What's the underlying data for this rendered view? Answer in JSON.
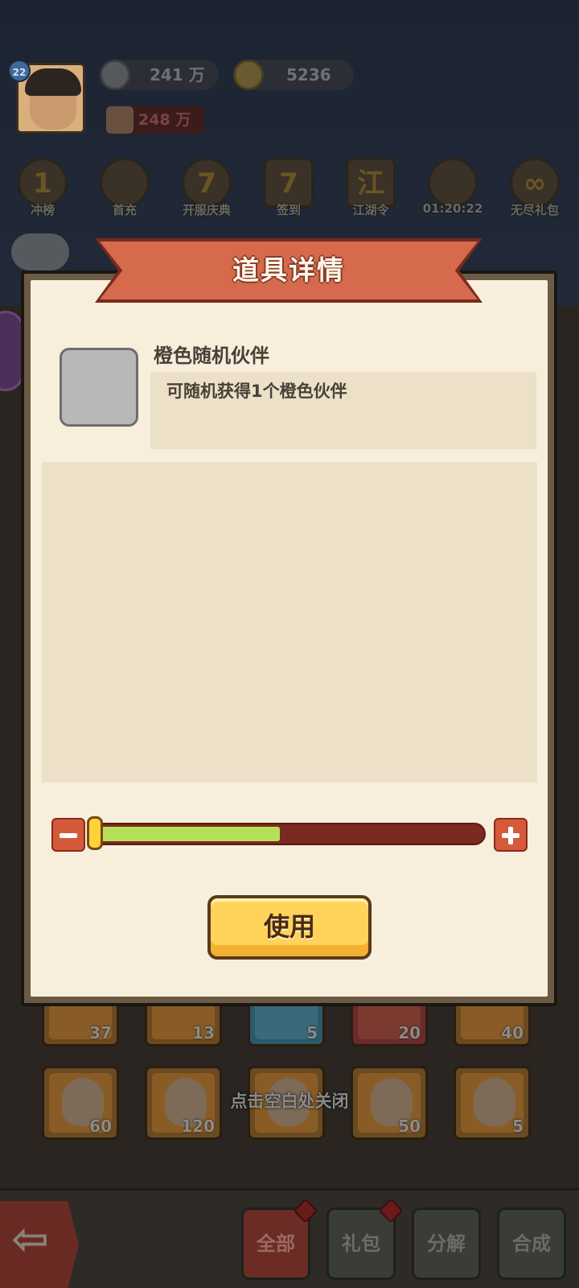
{
  "player": {
    "level": "22",
    "silver": "241 万",
    "gold": "5236",
    "power": "248 万"
  },
  "menu": [
    {
      "label": "冲榜",
      "glyph": "1",
      "icon": "rank-icon"
    },
    {
      "label": "首充",
      "glyph": "",
      "icon": "first-charge-icon"
    },
    {
      "label": "开服庆典",
      "glyph": "7",
      "icon": "celebration-icon"
    },
    {
      "label": "签到",
      "glyph": "7",
      "icon": "calendar-icon"
    },
    {
      "label": "江湖令",
      "glyph": "江",
      "icon": "token-icon"
    },
    {
      "label": "01:20:22",
      "glyph": "",
      "icon": "gift-icon"
    },
    {
      "label": "无尽礼包",
      "glyph": "∞",
      "icon": "infinity-icon"
    }
  ],
  "grid": {
    "row1_counts": [
      "37",
      "13",
      "5",
      "20",
      "40"
    ],
    "row2_counts": [
      "60",
      "120",
      "",
      "50",
      "5"
    ]
  },
  "dialog": {
    "title": "道具详情",
    "item_name": "橙色随机伙伴",
    "item_desc": "可随机获得1个橙色伙伴",
    "use_label": "使用",
    "slider_fraction": 0.48
  },
  "close_hint": "点击空白处关闭",
  "tabs": [
    {
      "label": "全部",
      "active": true,
      "dot": true
    },
    {
      "label": "礼包",
      "active": false,
      "dot": true
    },
    {
      "label": "分解",
      "active": false,
      "dot": false
    },
    {
      "label": "合成",
      "active": false,
      "dot": false
    }
  ],
  "colors": {
    "ribbon": "#d56a4c",
    "dialog_bg": "#f7efdc",
    "slider_fill": "#b5e05a",
    "slider_track": "#7a2a1e",
    "use_button": "#ffd25a"
  }
}
